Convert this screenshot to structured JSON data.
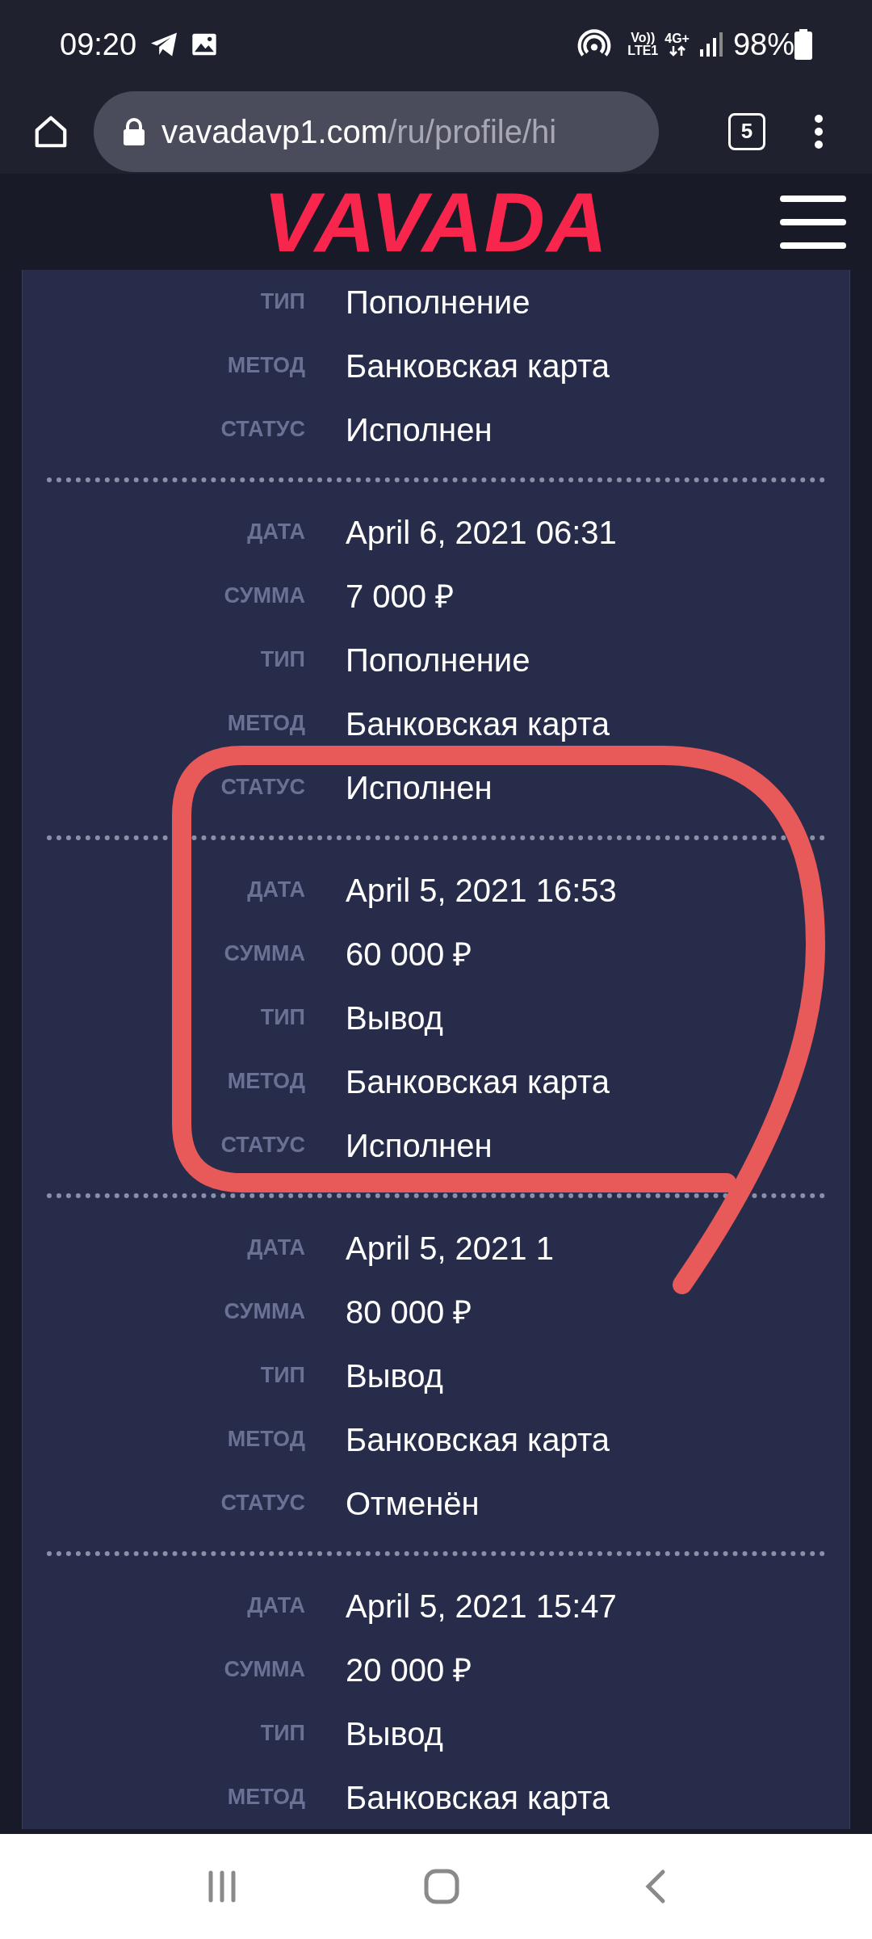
{
  "status_bar": {
    "time": "09:20",
    "network_top": "Vo))",
    "network_bottom": "LTE1",
    "data_type": "4G+",
    "battery": "98%"
  },
  "browser": {
    "url_host": "vavadavp1.com",
    "url_path": "/ru/profile/hi",
    "tab_count": "5"
  },
  "site": {
    "logo": "VAVADA"
  },
  "records": [
    {
      "fields": [
        {
          "label": "ТИП",
          "value": "Пополнение"
        },
        {
          "label": "МЕТОД",
          "value": "Банковская карта"
        },
        {
          "label": "СТАТУС",
          "value": "Исполнен"
        }
      ]
    },
    {
      "fields": [
        {
          "label": "ДАТА",
          "value": "April 6, 2021 06:31"
        },
        {
          "label": "СУММА",
          "value": "7 000 ₽"
        },
        {
          "label": "ТИП",
          "value": "Пополнение"
        },
        {
          "label": "МЕТОД",
          "value": "Банковская карта"
        },
        {
          "label": "СТАТУС",
          "value": "Исполнен"
        }
      ]
    },
    {
      "fields": [
        {
          "label": "ДАТА",
          "value": "April 5, 2021 16:53"
        },
        {
          "label": "СУММА",
          "value": "60 000 ₽"
        },
        {
          "label": "ТИП",
          "value": "Вывод"
        },
        {
          "label": "МЕТОД",
          "value": "Банковская карта"
        },
        {
          "label": "СТАТУС",
          "value": "Исполнен"
        }
      ]
    },
    {
      "fields": [
        {
          "label": "ДАТА",
          "value": "April 5, 2021 1"
        },
        {
          "label": "СУММА",
          "value": "80 000 ₽"
        },
        {
          "label": "ТИП",
          "value": "Вывод"
        },
        {
          "label": "МЕТОД",
          "value": "Банковская карта"
        },
        {
          "label": "СТАТУС",
          "value": "Отменён"
        }
      ]
    },
    {
      "fields": [
        {
          "label": "ДАТА",
          "value": "April 5, 2021 15:47"
        },
        {
          "label": "СУММА",
          "value": "20 000 ₽"
        },
        {
          "label": "ТИП",
          "value": "Вывод"
        },
        {
          "label": "МЕТОД",
          "value": "Банковская карта"
        }
      ]
    }
  ]
}
